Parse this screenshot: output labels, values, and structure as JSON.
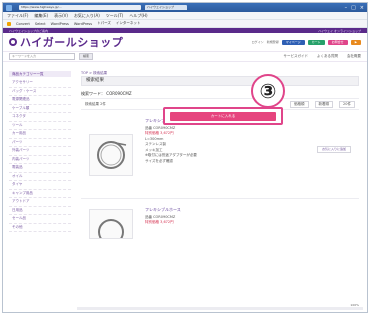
{
  "browser": {
    "url_text": "https://www.highways.jp/...",
    "tab_label": "ハイウェイショップ",
    "menu": [
      "ファイル(F)",
      "編集(E)",
      "表示(V)",
      "お気に入り(A)",
      "ツール(T)",
      "ヘルプ(H)"
    ],
    "favorites": [
      "Convert",
      "Select",
      "WordPress",
      "WordPress",
      "トパーズ",
      "インターネット"
    ]
  },
  "site": {
    "purple_bar_left": "ハイウェイショップのご案内",
    "purple_bar_right": "ハイウェイ オンラインショップ",
    "logo_text": "ハイガールショップ",
    "header_links": [
      "ログイン",
      "新規登録"
    ],
    "header_buttons": [
      "マイページ",
      "カート",
      "お問合せ"
    ],
    "search_placeholder": "キーワードを入力",
    "search_button": "検索",
    "nav_links": [
      "サービスガイド",
      "よくある質問",
      "会社概要"
    ]
  },
  "sidebar": {
    "title": "商品カテゴリー一覧",
    "items": [
      "アクセサリー",
      "バッグ・ケース",
      "電源関連品",
      "ケーブル類",
      "コネクタ",
      "ツール",
      "カー用品",
      "パーツ",
      "外装パーツ",
      "内装パーツ",
      "電装品",
      "オイル",
      "タイヤ",
      "キャンプ用品",
      "アウトドア",
      "日用品",
      "セール品",
      "その他"
    ]
  },
  "main": {
    "breadcrumb": "TOP > 検索結果",
    "heading": "検索結果",
    "condition": "検索ワード： COR090CMZ",
    "sort_text": "検索結果 2件",
    "sort_buttons": [
      "価格順",
      "新着順",
      "20件"
    ],
    "products": [
      {
        "name": "フレキシブルホース",
        "code": "品番 COR090CMZ",
        "price": "特別価格 3,672円",
        "lines": [
          "L=300mm",
          "ステンレス製",
          "メッキ加工",
          "※取付には別途アダプターが必要",
          "サイズを必ず確認"
        ],
        "fav": "お気に入りに追加",
        "cart": "カートに入れる"
      },
      {
        "name": "フレキシブルホース",
        "code": "品番 COR090CMZ",
        "price": "特別価格 3,672円"
      }
    ]
  },
  "badge": "③",
  "status_zoom": "100%"
}
